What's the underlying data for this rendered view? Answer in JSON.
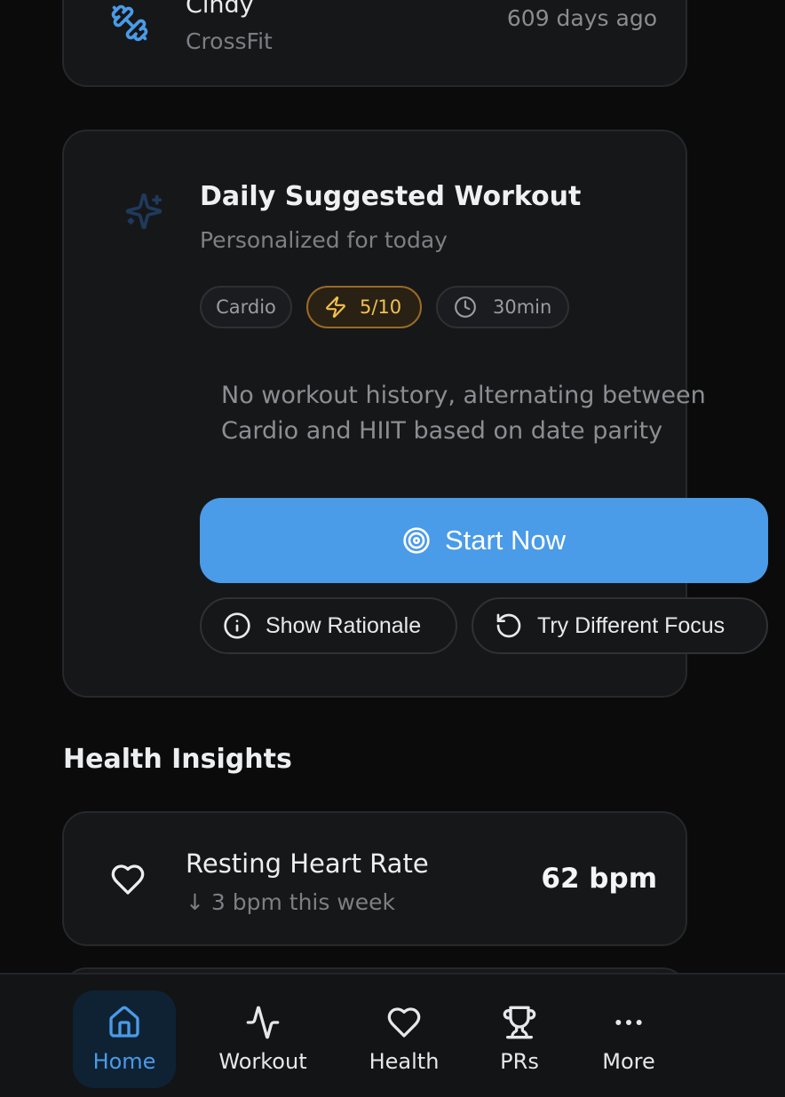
{
  "recent_workout": {
    "name": "Cindy",
    "category": "CrossFit",
    "time_ago": "609 days ago",
    "icon": "dumbbell-icon"
  },
  "daily_workout": {
    "title": "Daily Suggested Workout",
    "subtitle": "Personalized for today",
    "type_chip": "Cardio",
    "intensity": "5/10",
    "duration": "30min",
    "description": "No workout history, alternating between Cardio and HIIT based on date parity",
    "start_label": "Start Now",
    "rationale_label": "Show Rationale",
    "focus_label": "Try Different Focus"
  },
  "health_insights": {
    "section_title": "Health Insights",
    "items": [
      {
        "title": "Resting Heart Rate",
        "trend": "↓ 3 bpm this week",
        "value": "62 bpm"
      }
    ]
  },
  "bottom_nav": {
    "items": [
      {
        "label": "Home",
        "icon": "home-icon",
        "active": true
      },
      {
        "label": "Workout",
        "icon": "activity-icon",
        "active": false
      },
      {
        "label": "Health",
        "icon": "heart-icon",
        "active": false
      },
      {
        "label": "PRs",
        "icon": "trophy-icon",
        "active": false
      },
      {
        "label": "More",
        "icon": "more-icon",
        "active": false
      }
    ]
  },
  "colors": {
    "accent": "#4a9be8",
    "background": "#0b0b0c",
    "card": "#161719",
    "intensity": "#f2c14e"
  }
}
